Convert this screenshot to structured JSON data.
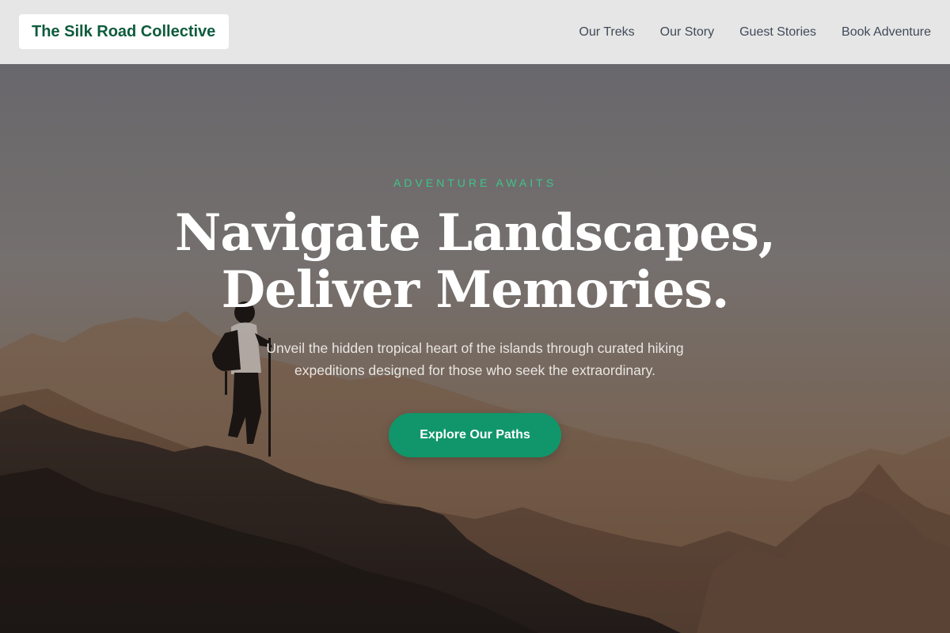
{
  "header": {
    "logo_text": "The Silk Road Collective",
    "nav": [
      {
        "label": "Our Treks"
      },
      {
        "label": "Our Story"
      },
      {
        "label": "Guest Stories"
      },
      {
        "label": "Book Adventure"
      }
    ]
  },
  "hero": {
    "eyebrow": "ADVENTURE AWAITS",
    "headline_line1": "Navigate Landscapes,",
    "headline_line2": "Deliver Memories.",
    "subhead": "Unveil the hidden tropical heart of the islands through curated hiking expeditions designed for those who seek the extraordinary.",
    "cta_label": "Explore Our Paths"
  },
  "colors": {
    "brand_green": "#0e5b3d",
    "accent_green": "#10966a",
    "eyebrow_green": "#3ec48a",
    "header_bg": "#e6e6e6",
    "nav_text": "#3f4a58"
  },
  "icons": {
    "hero_image": "hiker-silhouette-on-mountain-ridge"
  }
}
